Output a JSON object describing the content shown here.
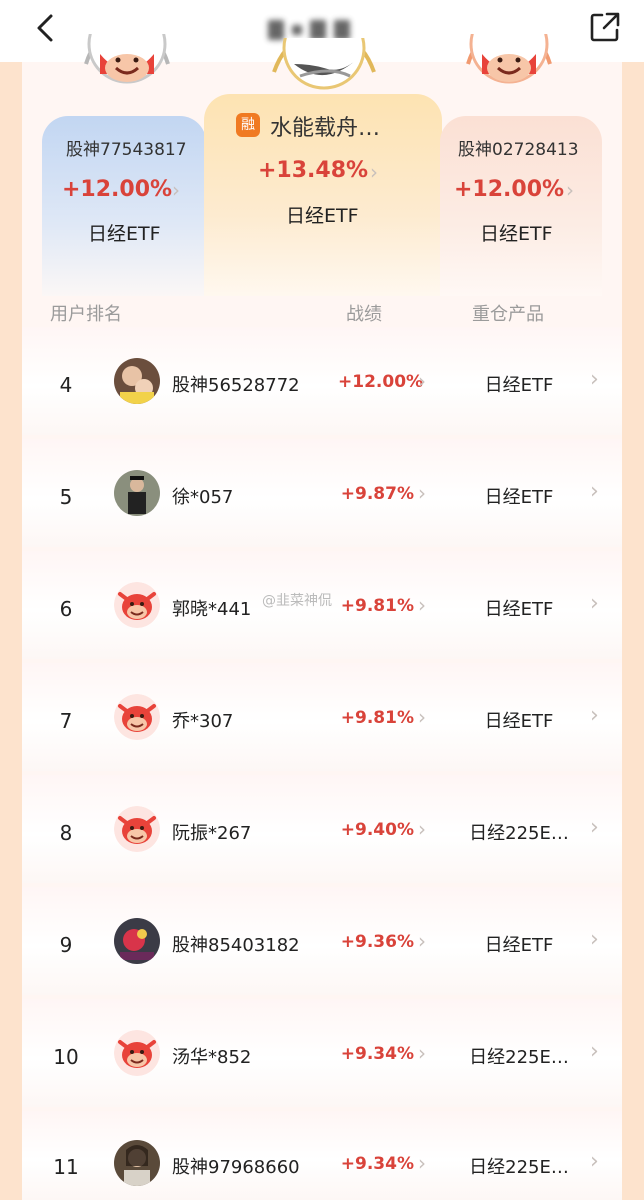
{
  "header": {
    "title": ""
  },
  "top3": {
    "left": {
      "name": "股神77543817",
      "return": "+12.00%",
      "product": "日经ETF"
    },
    "center": {
      "name": "水能载舟…",
      "badge": "融",
      "return": "+13.48%",
      "product": "日经ETF"
    },
    "right": {
      "name": "股神02728413",
      "return": "+12.00%",
      "product": "日经ETF"
    }
  },
  "columns": {
    "user_rank": "用户排名",
    "performance": "战绩",
    "top_holding": "重仓产品"
  },
  "rows": [
    {
      "rank": "4",
      "name": "股神56528772",
      "return": "+12.00%",
      "product": "日经ETF",
      "avatar": "photo-avatar"
    },
    {
      "rank": "5",
      "name": "徐*057",
      "return": "+9.87%",
      "product": "日经ETF",
      "avatar": "photo-avatar"
    },
    {
      "rank": "6",
      "name": "郭晓*441",
      "return": "+9.81%",
      "product": "日经ETF",
      "avatar": "bull-mascot-icon"
    },
    {
      "rank": "7",
      "name": "乔*307",
      "return": "+9.81%",
      "product": "日经ETF",
      "avatar": "bull-mascot-icon"
    },
    {
      "rank": "8",
      "name": "阮振*267",
      "return": "+9.40%",
      "product": "日经225E…",
      "avatar": "bull-mascot-icon"
    },
    {
      "rank": "9",
      "name": "股神85403182",
      "return": "+9.36%",
      "product": "日经ETF",
      "avatar": "photo-avatar"
    },
    {
      "rank": "10",
      "name": "汤华*852",
      "return": "+9.34%",
      "product": "日经225E…",
      "avatar": "bull-mascot-icon"
    },
    {
      "rank": "11",
      "name": "股神97968660",
      "return": "+9.34%",
      "product": "日经225E…",
      "avatar": "photo-avatar"
    }
  ],
  "watermark": "@韭菜神侃",
  "colors": {
    "accent_red": "#d9433a",
    "frame": "#fde3cd",
    "silver": "#c2d6f2",
    "gold": "#fde3b2",
    "bronze": "#fbe0d4"
  }
}
